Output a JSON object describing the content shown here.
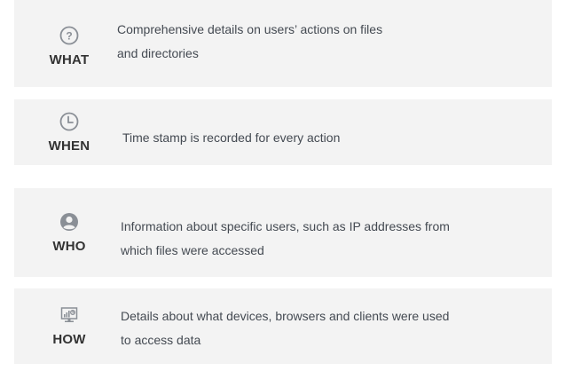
{
  "items": [
    {
      "label": "WHAT",
      "icon": "question-icon",
      "description_line1": "Comprehensive details on users’ actions on files",
      "description_line2": "and directories"
    },
    {
      "label": "WHEN",
      "icon": "clock-icon",
      "description_line1": "Time stamp is recorded for every action",
      "description_line2": ""
    },
    {
      "label": "WHO",
      "icon": "user-icon",
      "description_line1": "Information about specific users, such as IP addresses from",
      "description_line2": "which files were accessed"
    },
    {
      "label": "HOW",
      "icon": "monitor-chart-icon",
      "description_line1": "Details about what devices, browsers and clients were used",
      "description_line2": "to access data"
    }
  ],
  "colors": {
    "card_background": "#f3f3f3",
    "icon_gray": "#8a8f96",
    "text": "#444a52"
  }
}
